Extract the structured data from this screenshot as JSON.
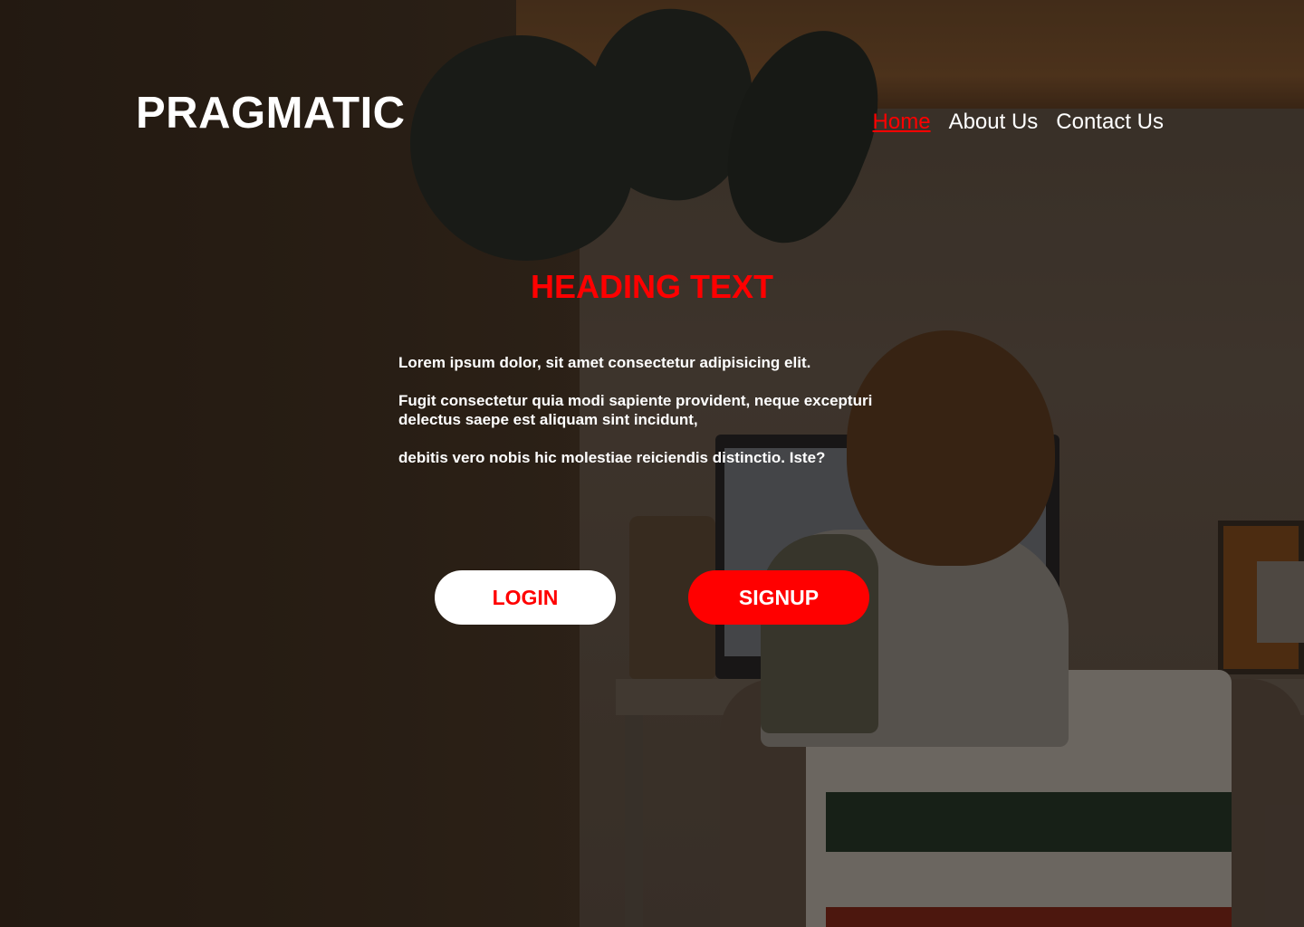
{
  "brand": {
    "name": "PRAGMATIC"
  },
  "nav": {
    "items": [
      {
        "label": "Home",
        "active": true
      },
      {
        "label": "About Us",
        "active": false
      },
      {
        "label": "Contact Us",
        "active": false
      }
    ]
  },
  "hero": {
    "heading": "HEADING TEXT",
    "paragraphs": [
      "Lorem ipsum dolor, sit amet consectetur adipisicing elit.",
      "Fugit consectetur quia modi sapiente provident, neque excepturi delectus saepe est aliquam sint incidunt,",
      "debitis vero nobis hic molestiae reiciendis distinctio. Iste?"
    ]
  },
  "actions": {
    "login_label": "LOGIN",
    "signup_label": "SIGNUP"
  },
  "colors": {
    "accent": "#ff0000",
    "text": "#ffffff",
    "button_light": "#ffffff"
  }
}
